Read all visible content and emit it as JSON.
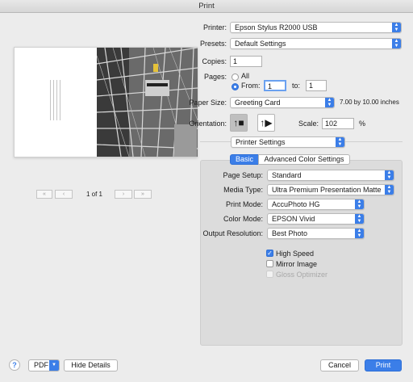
{
  "window": {
    "title": "Print"
  },
  "printer": {
    "label": "Printer:",
    "value": "Epson Stylus R2000 USB"
  },
  "presets": {
    "label": "Presets:",
    "value": "Default Settings"
  },
  "copies": {
    "label": "Copies:",
    "value": "1"
  },
  "pages": {
    "label": "Pages:",
    "all_label": "All",
    "from_label": "From:",
    "from_value": "1",
    "to_label": "to:",
    "to_value": "1",
    "selected": "from"
  },
  "paper_size": {
    "label": "Paper Size:",
    "value": "Greeting Card",
    "dimensions": "7.00 by 10.00 inches"
  },
  "orientation": {
    "label": "Orientation:",
    "selected": "portrait"
  },
  "scale": {
    "label": "Scale:",
    "value": "102",
    "unit": "%"
  },
  "section_popup": {
    "value": "Printer Settings"
  },
  "tabs": [
    {
      "label": "Basic",
      "active": true
    },
    {
      "label": "Advanced Color Settings",
      "active": false
    }
  ],
  "settings": {
    "page_setup": {
      "label": "Page Setup:",
      "value": "Standard"
    },
    "media_type": {
      "label": "Media Type:",
      "value": "Ultra Premium Presentation Matte"
    },
    "print_mode": {
      "label": "Print Mode:",
      "value": "AccuPhoto HG"
    },
    "color_mode": {
      "label": "Color Mode:",
      "value": "EPSON Vivid"
    },
    "output_resolution": {
      "label": "Output Resolution:",
      "value": "Best Photo"
    },
    "high_speed": {
      "label": "High Speed",
      "checked": true,
      "enabled": true
    },
    "mirror_image": {
      "label": "Mirror Image",
      "checked": false,
      "enabled": true
    },
    "gloss_optimizer": {
      "label": "Gloss Optimizer",
      "checked": false,
      "enabled": false
    }
  },
  "preview": {
    "page_indicator": "1 of 1"
  },
  "footer": {
    "help_label": "?",
    "pdf_label": "PDF",
    "hide_details_label": "Hide Details",
    "cancel_label": "Cancel",
    "print_label": "Print"
  },
  "colors": {
    "accent": "#3b7ee8",
    "panel": "#dcdcdc",
    "window": "#ececec"
  }
}
